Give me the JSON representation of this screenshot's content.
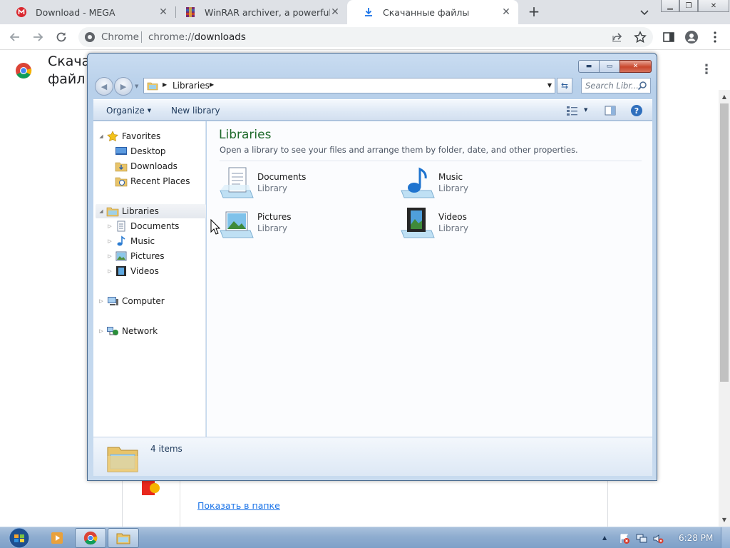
{
  "browser": {
    "tabs": [
      {
        "title": "Download - MEGA",
        "icon": "mega-icon",
        "active": false
      },
      {
        "title": "WinRAR archiver, a powerful tool",
        "icon": "winrar-icon",
        "active": false
      },
      {
        "title": "Скачанные файлы",
        "icon": "download-icon",
        "active": true
      }
    ],
    "new_tab": "+",
    "omnibox": {
      "label": "Chrome",
      "url_scheme": "chrome://",
      "url_host": "downloads"
    }
  },
  "downloads_page": {
    "title": "Скача файл",
    "show_in_folder": "Показать в папке"
  },
  "explorer": {
    "address": {
      "root": "Libraries"
    },
    "search": {
      "placeholder": "Search Libr..."
    },
    "commands": {
      "organize": "Organize",
      "new_library": "New library"
    },
    "nav": {
      "favorites": {
        "label": "Favorites",
        "items": [
          "Desktop",
          "Downloads",
          "Recent Places"
        ]
      },
      "libraries": {
        "label": "Libraries",
        "items": [
          "Documents",
          "Music",
          "Pictures",
          "Videos"
        ]
      },
      "computer": "Computer",
      "network": "Network"
    },
    "content": {
      "title": "Libraries",
      "description": "Open a library to see your files and arrange them by folder, date, and other properties.",
      "items": [
        {
          "name": "Documents",
          "type": "Library",
          "icon": "documents-library-icon"
        },
        {
          "name": "Music",
          "type": "Library",
          "icon": "music-library-icon"
        },
        {
          "name": "Pictures",
          "type": "Library",
          "icon": "pictures-library-icon"
        },
        {
          "name": "Videos",
          "type": "Library",
          "icon": "videos-library-icon"
        }
      ]
    },
    "details": {
      "count": "4 items"
    }
  },
  "taskbar": {
    "clock": "6:28 PM",
    "apps": [
      "media-player-icon",
      "chrome-icon",
      "explorer-icon"
    ]
  },
  "colors": {
    "library_title": "#1e6a2a",
    "link": "#1a73e8",
    "tab_strip": "#dee1e6"
  }
}
